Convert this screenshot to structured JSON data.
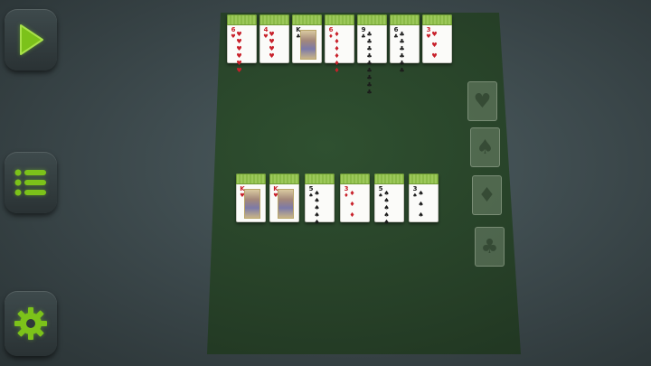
{
  "menu": {
    "play_icon": "play-triangle-icon",
    "menu_icon": "hamburger-list-icon",
    "settings_icon": "gear-icon",
    "accent_color": "#7cc21a"
  },
  "colors": {
    "felt": "#263f27",
    "background": "#3a4649",
    "card_back_strip": "#9cc85a",
    "red_suit": "#c8202a",
    "black_suit": "#1a1a1a"
  },
  "top_row": [
    {
      "rank": "6",
      "suit": "♥",
      "color": "red"
    },
    {
      "rank": "4",
      "suit": "♥",
      "color": "red"
    },
    {
      "rank": "K",
      "suit": "♣",
      "color": "black"
    },
    {
      "rank": "6",
      "suit": "♦",
      "color": "red"
    },
    {
      "rank": "9",
      "suit": "♣",
      "color": "black"
    },
    {
      "rank": "6",
      "suit": "♣",
      "color": "black"
    },
    {
      "rank": "3",
      "suit": "♥",
      "color": "red"
    }
  ],
  "bottom_row": [
    {
      "rank": "K",
      "suit": "♥",
      "color": "red"
    },
    {
      "rank": "K",
      "suit": "♥",
      "color": "red"
    },
    {
      "rank": "5",
      "suit": "♠",
      "color": "black"
    },
    {
      "rank": "3",
      "suit": "♦",
      "color": "red"
    },
    {
      "rank": "5",
      "suit": "♠",
      "color": "black"
    },
    {
      "rank": "3",
      "suit": "♠",
      "color": "black"
    }
  ],
  "foundations": [
    {
      "suit": "♥"
    },
    {
      "suit": "♠"
    },
    {
      "suit": "♦"
    },
    {
      "suit": "♣"
    }
  ]
}
